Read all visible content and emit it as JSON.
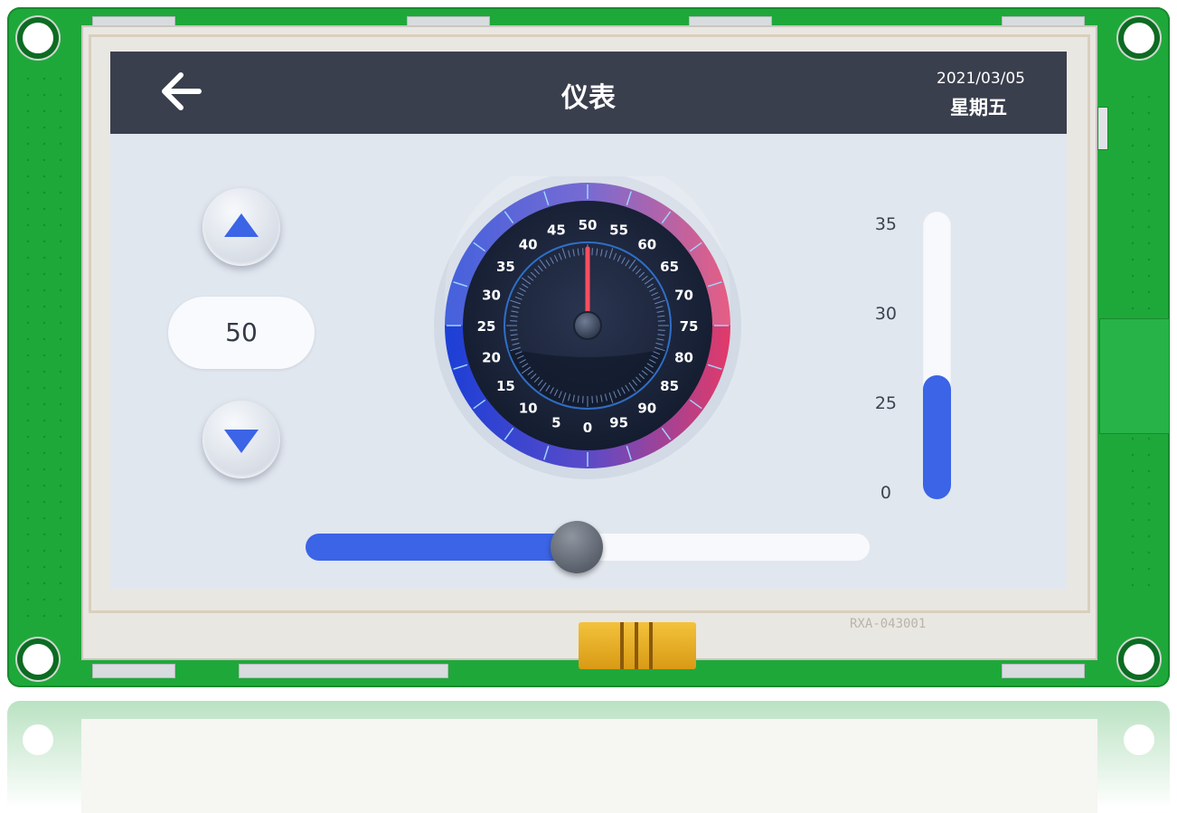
{
  "header": {
    "back_icon": "arrow-left-icon",
    "title": "仪表",
    "date": "2021/03/05",
    "weekday": "星期五"
  },
  "stepper": {
    "up_icon": "triangle-up-icon",
    "down_icon": "triangle-down-icon",
    "value": "50"
  },
  "gauge": {
    "value": 50,
    "min": 0,
    "max": 95,
    "tick_labels": [
      "0",
      "5",
      "10",
      "15",
      "20",
      "25",
      "30",
      "35",
      "40",
      "45",
      "50",
      "55",
      "60",
      "65",
      "70",
      "75",
      "80",
      "85",
      "90",
      "95"
    ]
  },
  "tank": {
    "scale_labels": [
      "35",
      "30",
      "25",
      "0"
    ],
    "fill_fraction": 0.43
  },
  "slider": {
    "fraction": 0.48
  },
  "colors": {
    "accent": "#3b64e6",
    "header_bg": "#3a3f4d",
    "screen_bg": "#e1e7ef",
    "needle": "#ff4d5e"
  },
  "board": {
    "silkscreen": "RXA-043001"
  }
}
